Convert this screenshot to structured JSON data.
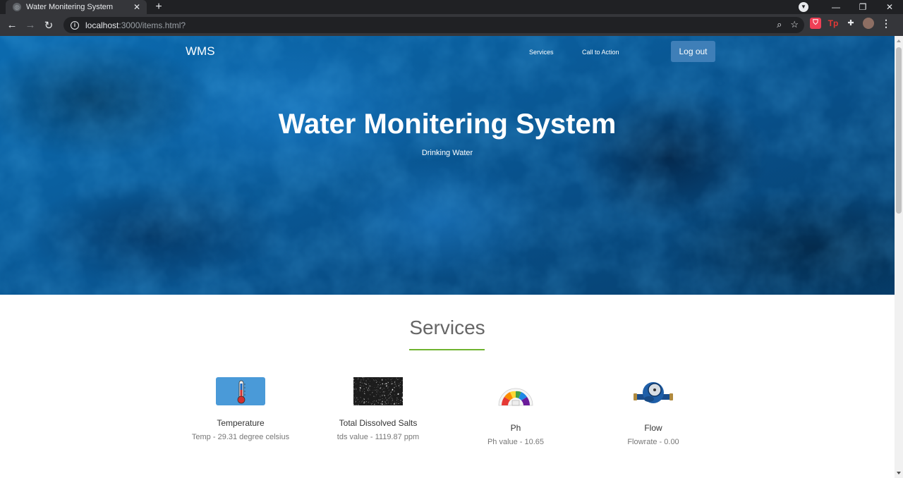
{
  "browser": {
    "tab_title": "Water Monitering System",
    "url_host": "localhost",
    "url_rest": ":3000/items.html?",
    "new_tab_glyph": "+",
    "close_tab_glyph": "✕"
  },
  "navbar": {
    "brand": "WMS",
    "links": [
      "Services",
      "Call to Action"
    ],
    "logout_label": "Log out"
  },
  "hero": {
    "title": "Water Monitering System",
    "subtitle": "Drinking Water"
  },
  "services": {
    "heading": "Services",
    "accent_color": "#6fb32f",
    "items": [
      {
        "icon": "thermometer-icon",
        "name": "Temperature",
        "value": "Temp - 29.31 degree celsius"
      },
      {
        "icon": "salt-crystals-image",
        "name": "Total Dissolved Salts",
        "value": "tds value - 1119.87 ppm"
      },
      {
        "icon": "ph-scale-icon",
        "name": "Ph",
        "value": "Ph value - 10.65"
      },
      {
        "icon": "water-meter-icon",
        "name": "Flow",
        "value": "Flowrate - 0.00"
      }
    ]
  }
}
